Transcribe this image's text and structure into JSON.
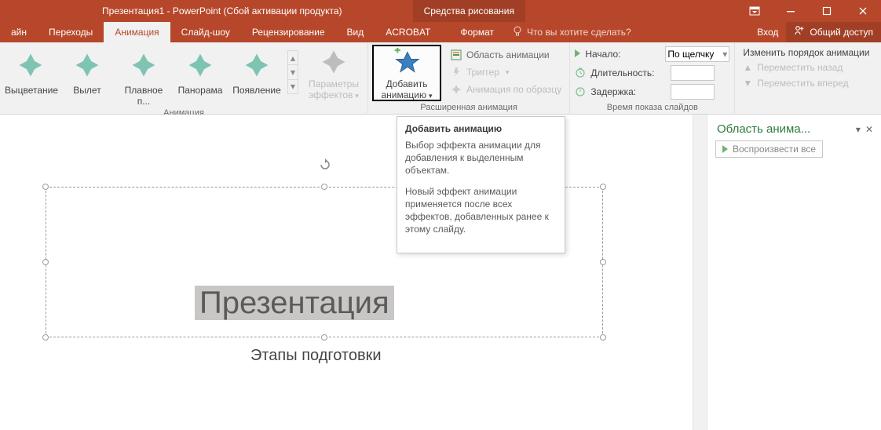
{
  "titlebar": {
    "title": "Презентация1 - PowerPoint (Сбой активации продукта)",
    "context_tab_group": "Средства рисования"
  },
  "tabs": {
    "t0": "айн",
    "t1": "Переходы",
    "t2": "Анимация",
    "t3": "Слайд-шоу",
    "t4": "Рецензирование",
    "t5": "Вид",
    "t6": "ACROBAT",
    "t7": "Формат",
    "tell_me": "Что вы хотите сделать?",
    "signin": "Вход",
    "share": "Общий доступ"
  },
  "ribbon": {
    "gallery": {
      "g0": "Выцветание",
      "g1": "Вылет",
      "g2": "Плавное п...",
      "g3": "Панорама",
      "g4": "Появление"
    },
    "effect_options": "Параметры эффектов",
    "group_anim": "Анимация",
    "add_anim": "Добавить анимацию",
    "adv": {
      "pane": "Область анимации",
      "trigger": "Триггер",
      "painter": "Анимация по образцу",
      "label": "Расширенная анимация"
    },
    "timing": {
      "start_lbl": "Начало:",
      "start_val": "По щелчку",
      "dur_lbl": "Длительность:",
      "delay_lbl": "Задержка:",
      "label": "Время показа слайдов"
    },
    "reorder": {
      "hdr": "Изменить порядок анимации",
      "earlier": "Переместить назад",
      "later": "Переместить вперед"
    }
  },
  "tooltip": {
    "title": "Добавить анимацию",
    "p1": "Выбор эффекта анимации для добавления к выделенным объектам.",
    "p2": "Новый эффект анимации применяется после всех эффектов, добавленных ранее к этому слайду."
  },
  "pane": {
    "title": "Область анима...",
    "play": "Воспроизвести все"
  },
  "slide": {
    "title": "Презентация",
    "subtitle": "Этапы подготовки"
  }
}
